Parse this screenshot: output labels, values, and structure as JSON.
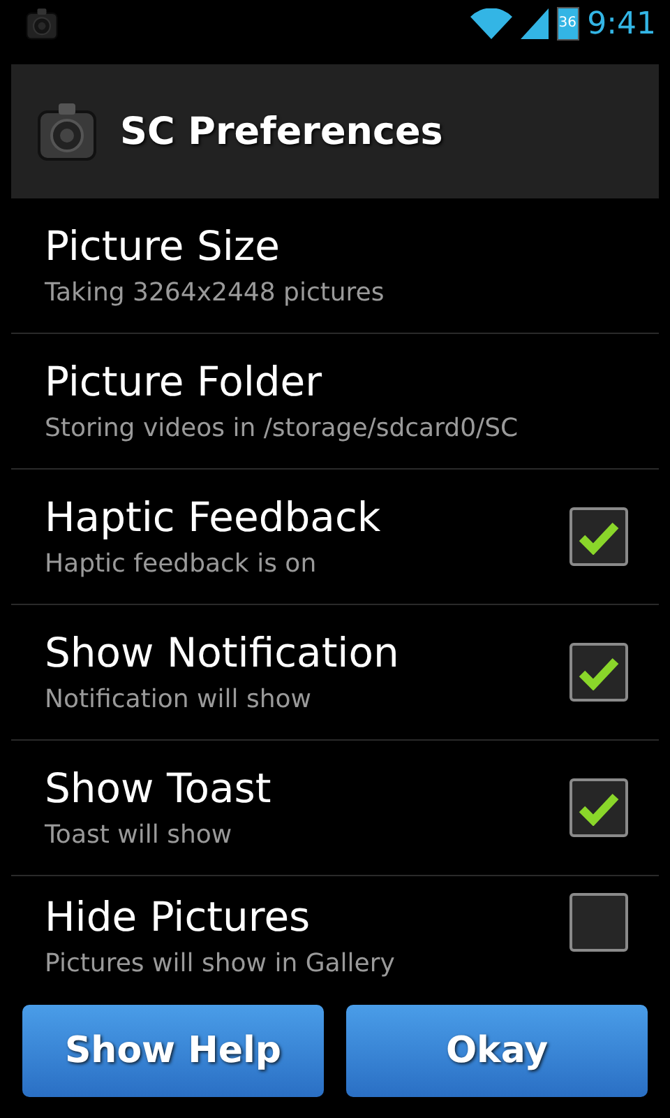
{
  "status_bar": {
    "battery": "36",
    "time": "9:41"
  },
  "title_bar": {
    "title": "SC Preferences"
  },
  "preferences": [
    {
      "kind": "plain",
      "title": "Picture Size",
      "summary": "Taking 3264x2448 pictures"
    },
    {
      "kind": "plain",
      "title": "Picture Folder",
      "summary": "Storing videos in /storage/sdcard0/SC"
    },
    {
      "kind": "checkbox",
      "title": "Haptic Feedback",
      "summary": "Haptic feedback is on",
      "checked": true
    },
    {
      "kind": "checkbox",
      "title": "Show Notification",
      "summary": "Notification will show",
      "checked": true
    },
    {
      "kind": "checkbox",
      "title": "Show Toast",
      "summary": "Toast will show",
      "checked": true
    },
    {
      "kind": "checkbox",
      "title": "Hide Pictures",
      "summary": "Pictures will show in Gallery",
      "checked": false
    }
  ],
  "buttons": [
    "Show Help",
    "Okay"
  ]
}
